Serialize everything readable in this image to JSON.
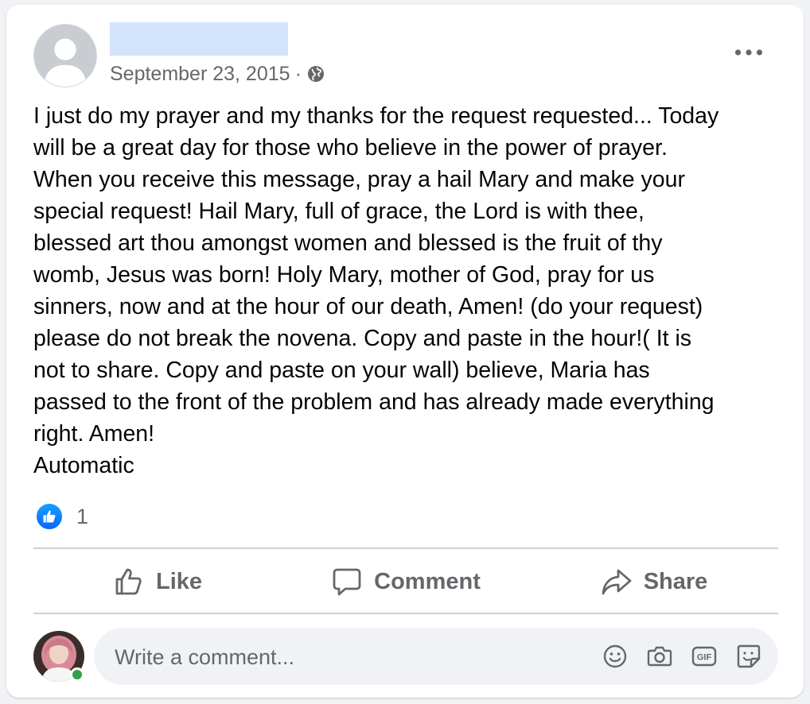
{
  "post": {
    "date": "September 23, 2015",
    "separator": "·",
    "privacy_icon": "globe-icon",
    "text": "I just do my prayer and my thanks for the request requested... Today\nwill be a great day for those who believe in the power of prayer.\nWhen you receive this message, pray a hail Mary and make your\nspecial request! Hail Mary, full of grace, the Lord is with thee,\nblessed art thou amongst women and blessed is the fruit of thy\nwomb, Jesus was born! Holy Mary, mother of God, pray for us\nsinners, now and at the hour of our death, Amen! (do your request)\nplease do not break the novena. Copy and paste in the hour!( It is\nnot to share. Copy and paste on your wall) believe, Maria has\npassed to the front of the problem and has already made everything\nright. Amen!\nAutomatic"
  },
  "reactions": {
    "icon": "like-reaction-icon",
    "count": "1"
  },
  "actions": {
    "like": "Like",
    "comment": "Comment",
    "share": "Share"
  },
  "comment_box": {
    "placeholder": "Write a comment..."
  },
  "colors": {
    "accent_blue": "#0866ff",
    "name_redaction": "#d2e3fc",
    "online_green": "#31a24c",
    "secondary_text": "#65676b"
  }
}
